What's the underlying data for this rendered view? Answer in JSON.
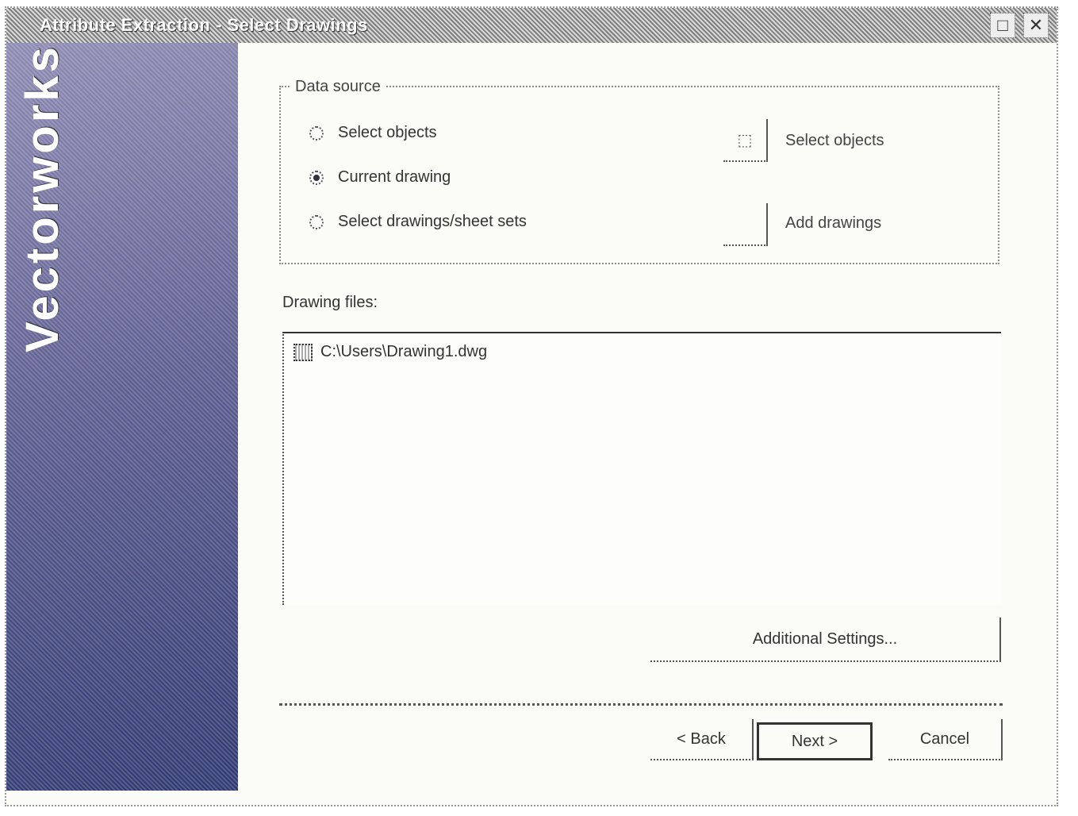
{
  "window": {
    "title": "Attribute Extraction - Select Drawings",
    "controls": [
      "□",
      "✕"
    ]
  },
  "sidebar": {
    "brand": "Vectorworks"
  },
  "source_group": {
    "legend": "Data source",
    "options": [
      {
        "label": "Select objects",
        "checked": false
      },
      {
        "label": "Current drawing",
        "checked": true
      },
      {
        "label": "Select drawings/sheet sets",
        "checked": false
      }
    ],
    "select_objects_button": {
      "glyph": "⬚",
      "label": "Select objects"
    },
    "add_drawings_button": {
      "glyph": "",
      "label": "Add drawings"
    }
  },
  "drawing_files": {
    "label": "Drawing files:",
    "items": [
      {
        "text": "C:\\Users\\Drawing1.dwg"
      }
    ]
  },
  "additional_settings_label": "Additional Settings...",
  "footer": {
    "back_label": "< Back",
    "next_label": "Next >",
    "cancel_label": "Cancel"
  }
}
